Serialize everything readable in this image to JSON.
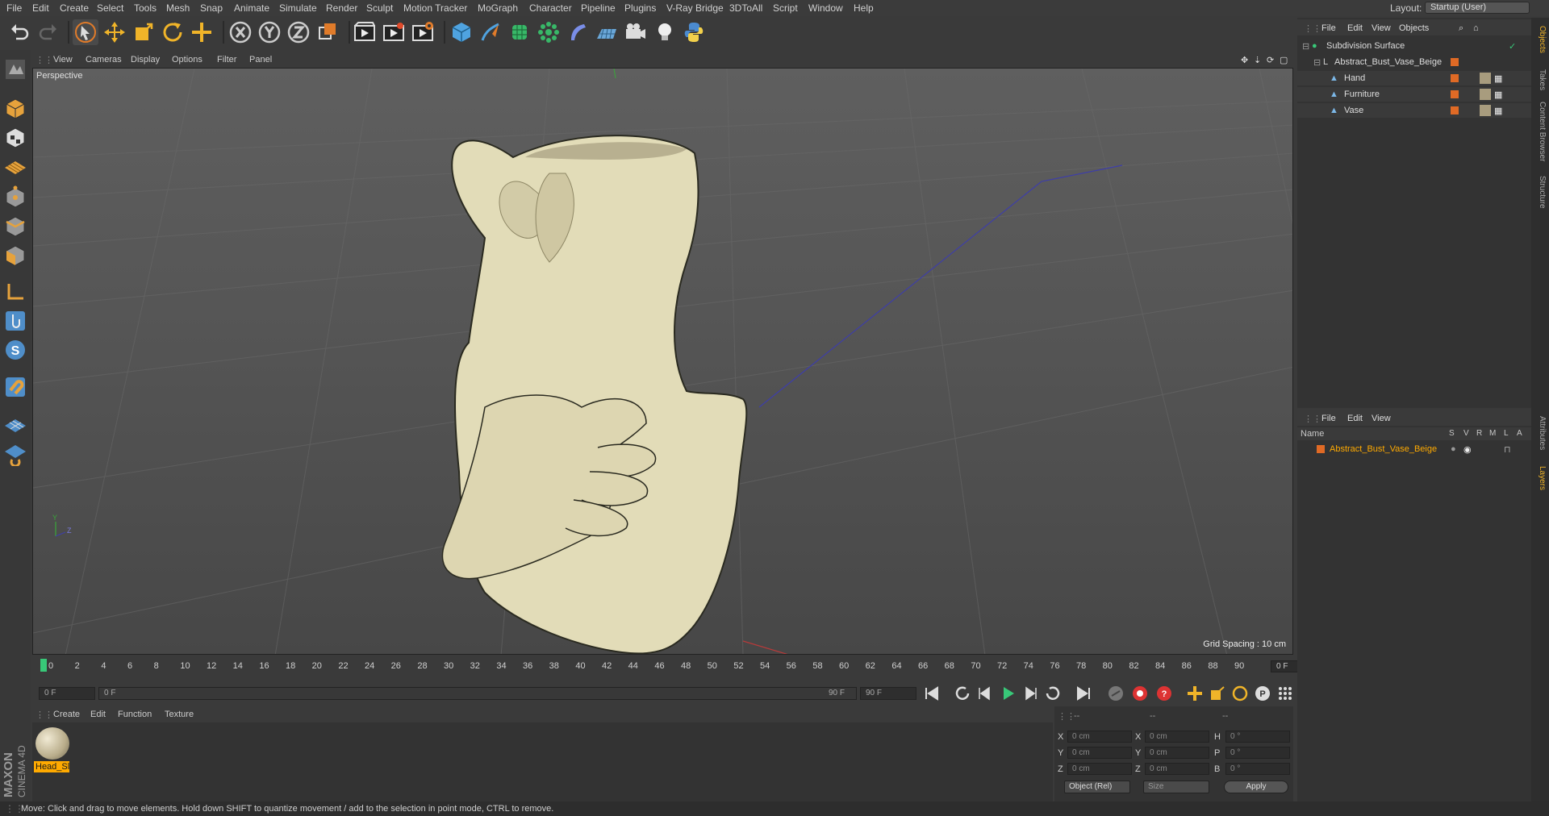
{
  "menubar": {
    "items": [
      "File",
      "Edit",
      "Create",
      "Select",
      "Tools",
      "Mesh",
      "Snap",
      "Animate",
      "Simulate",
      "Render",
      "Sculpt",
      "Motion Tracker",
      "MoGraph",
      "Character",
      "Pipeline",
      "Plugins",
      "V-Ray Bridge",
      "3DToAll",
      "Script",
      "Window",
      "Help"
    ],
    "layout_label": "Layout:",
    "layout_value": "Startup (User)"
  },
  "toolbar": {
    "icons": [
      "undo-icon",
      "redo-icon",
      "select-arrow-icon",
      "move-icon",
      "scale-icon",
      "rotate-icon",
      "move-plus-icon",
      "x-axis-icon",
      "y-axis-icon",
      "z-axis-icon",
      "coordinate-system-icon",
      "render-view-icon",
      "render-picture-viewer-icon",
      "edit-render-settings-icon",
      "cube-icon",
      "pen-icon",
      "subdivision-icon",
      "array-icon",
      "deformer-icon",
      "floor-icon",
      "camera-icon",
      "light-icon",
      "python-icon"
    ]
  },
  "left_toolbar": {
    "icons": [
      "make-editable-icon",
      "model-mode-icon",
      "texture-mode-icon",
      "workplane-icon",
      "points-mode-icon",
      "edges-mode-icon",
      "polygons-mode-icon",
      "axis-mode-icon",
      "tweak-mode-icon",
      "solo-mode-icon",
      "magnet-icon",
      "snap-grid-icon",
      "snap-settings-icon"
    ]
  },
  "viewport": {
    "menu": [
      "View",
      "Cameras",
      "Display",
      "Options",
      "Filter",
      "Panel"
    ],
    "camera_label": "Perspective",
    "grid_spacing": "Grid Spacing : 10 cm"
  },
  "timeline": {
    "ticks": [
      "0",
      "2",
      "4",
      "6",
      "8",
      "10",
      "12",
      "14",
      "16",
      "18",
      "20",
      "22",
      "24",
      "26",
      "28",
      "30",
      "32",
      "34",
      "36",
      "38",
      "40",
      "42",
      "44",
      "46",
      "48",
      "50",
      "52",
      "54",
      "56",
      "58",
      "60",
      "62",
      "64",
      "66",
      "68",
      "70",
      "72",
      "74",
      "76",
      "78",
      "80",
      "82",
      "84",
      "86",
      "88",
      "90"
    ],
    "current_frame": "0 F",
    "start_field": "0 F",
    "range_start": "0 F",
    "range_end": "90 F",
    "end_field": "90 F"
  },
  "materials": {
    "menu": [
      "Create",
      "Edit",
      "Function",
      "Texture"
    ],
    "items": [
      {
        "label": "Head_Sl"
      }
    ]
  },
  "coordinates": {
    "header": [
      "--",
      "--",
      "--"
    ],
    "rows": [
      {
        "axis1": "X",
        "val1": "0 cm",
        "axis2": "X",
        "val2": "0 cm",
        "axis3": "H",
        "val3": "0 °"
      },
      {
        "axis1": "Y",
        "val1": "0 cm",
        "axis2": "Y",
        "val2": "0 cm",
        "axis3": "P",
        "val3": "0 °"
      },
      {
        "axis1": "Z",
        "val1": "0 cm",
        "axis2": "Z",
        "val2": "0 cm",
        "axis3": "B",
        "val3": "0 °"
      }
    ],
    "mode_select": "Object (Rel)",
    "size_select": "Size",
    "apply_label": "Apply"
  },
  "objects_panel": {
    "menu": [
      "File",
      "Edit",
      "View",
      "Objects"
    ],
    "items": [
      {
        "name": "Subdivision Surface"
      },
      {
        "name": "Abstract_Bust_Vase_Beige"
      },
      {
        "name": "Hand"
      },
      {
        "name": "Furniture"
      },
      {
        "name": "Vase"
      }
    ]
  },
  "layers_panel": {
    "menu": [
      "File",
      "Edit",
      "View"
    ],
    "columns": [
      "Name",
      "S",
      "V",
      "R",
      "M",
      "L",
      "A"
    ],
    "items": [
      {
        "name": "Abstract_Bust_Vase_Beige"
      }
    ]
  },
  "right_tabs": [
    "Objects",
    "Takes",
    "Content Browser",
    "Structure",
    "Attributes",
    "Layers"
  ],
  "status": {
    "text": "Move: Click and drag to move elements. Hold down SHIFT to quantize movement / add to the selection in point mode, CTRL to remove."
  },
  "logo": {
    "brand": "MAXON",
    "product": "CINEMA 4D"
  },
  "colors": {
    "accent_orange": "#ffaa00",
    "layer_color": "#e06a25",
    "sculpture": "#e2dcb8"
  }
}
